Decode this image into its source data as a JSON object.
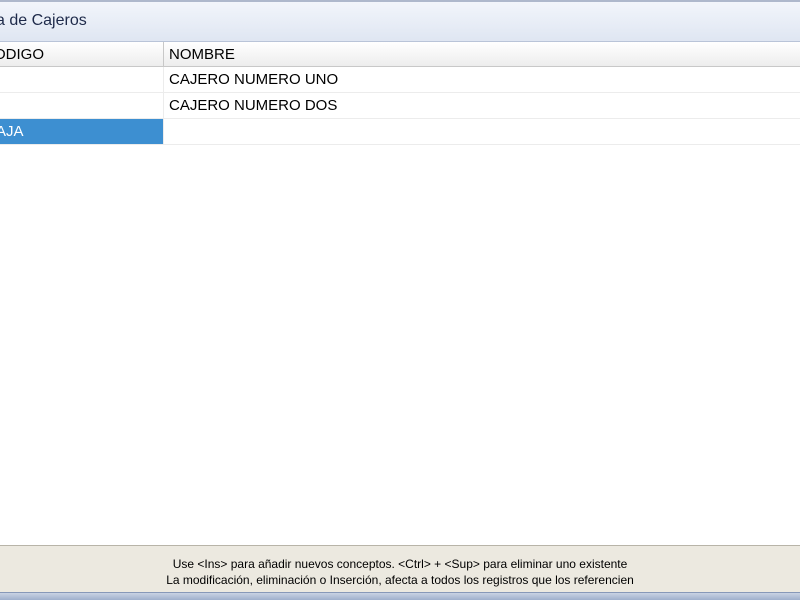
{
  "window": {
    "title": "a de Cajeros"
  },
  "grid": {
    "columns": [
      {
        "label": "ODIGO"
      },
      {
        "label": "NOMBRE"
      }
    ],
    "rows": [
      {
        "code": "",
        "name": "CAJERO NUMERO UNO"
      },
      {
        "code": "",
        "name": "CAJERO NUMERO DOS"
      },
      {
        "code": "AJA",
        "name": ""
      }
    ],
    "selection_color": "#3d8fd1"
  },
  "status": {
    "line1": "Use <Ins> para añadir nuevos conceptos. <Ctrl> + <Sup> para eliminar uno existente",
    "line2": "La modificación, eliminación o Inserción, afecta a todos los registros que los referencien"
  }
}
